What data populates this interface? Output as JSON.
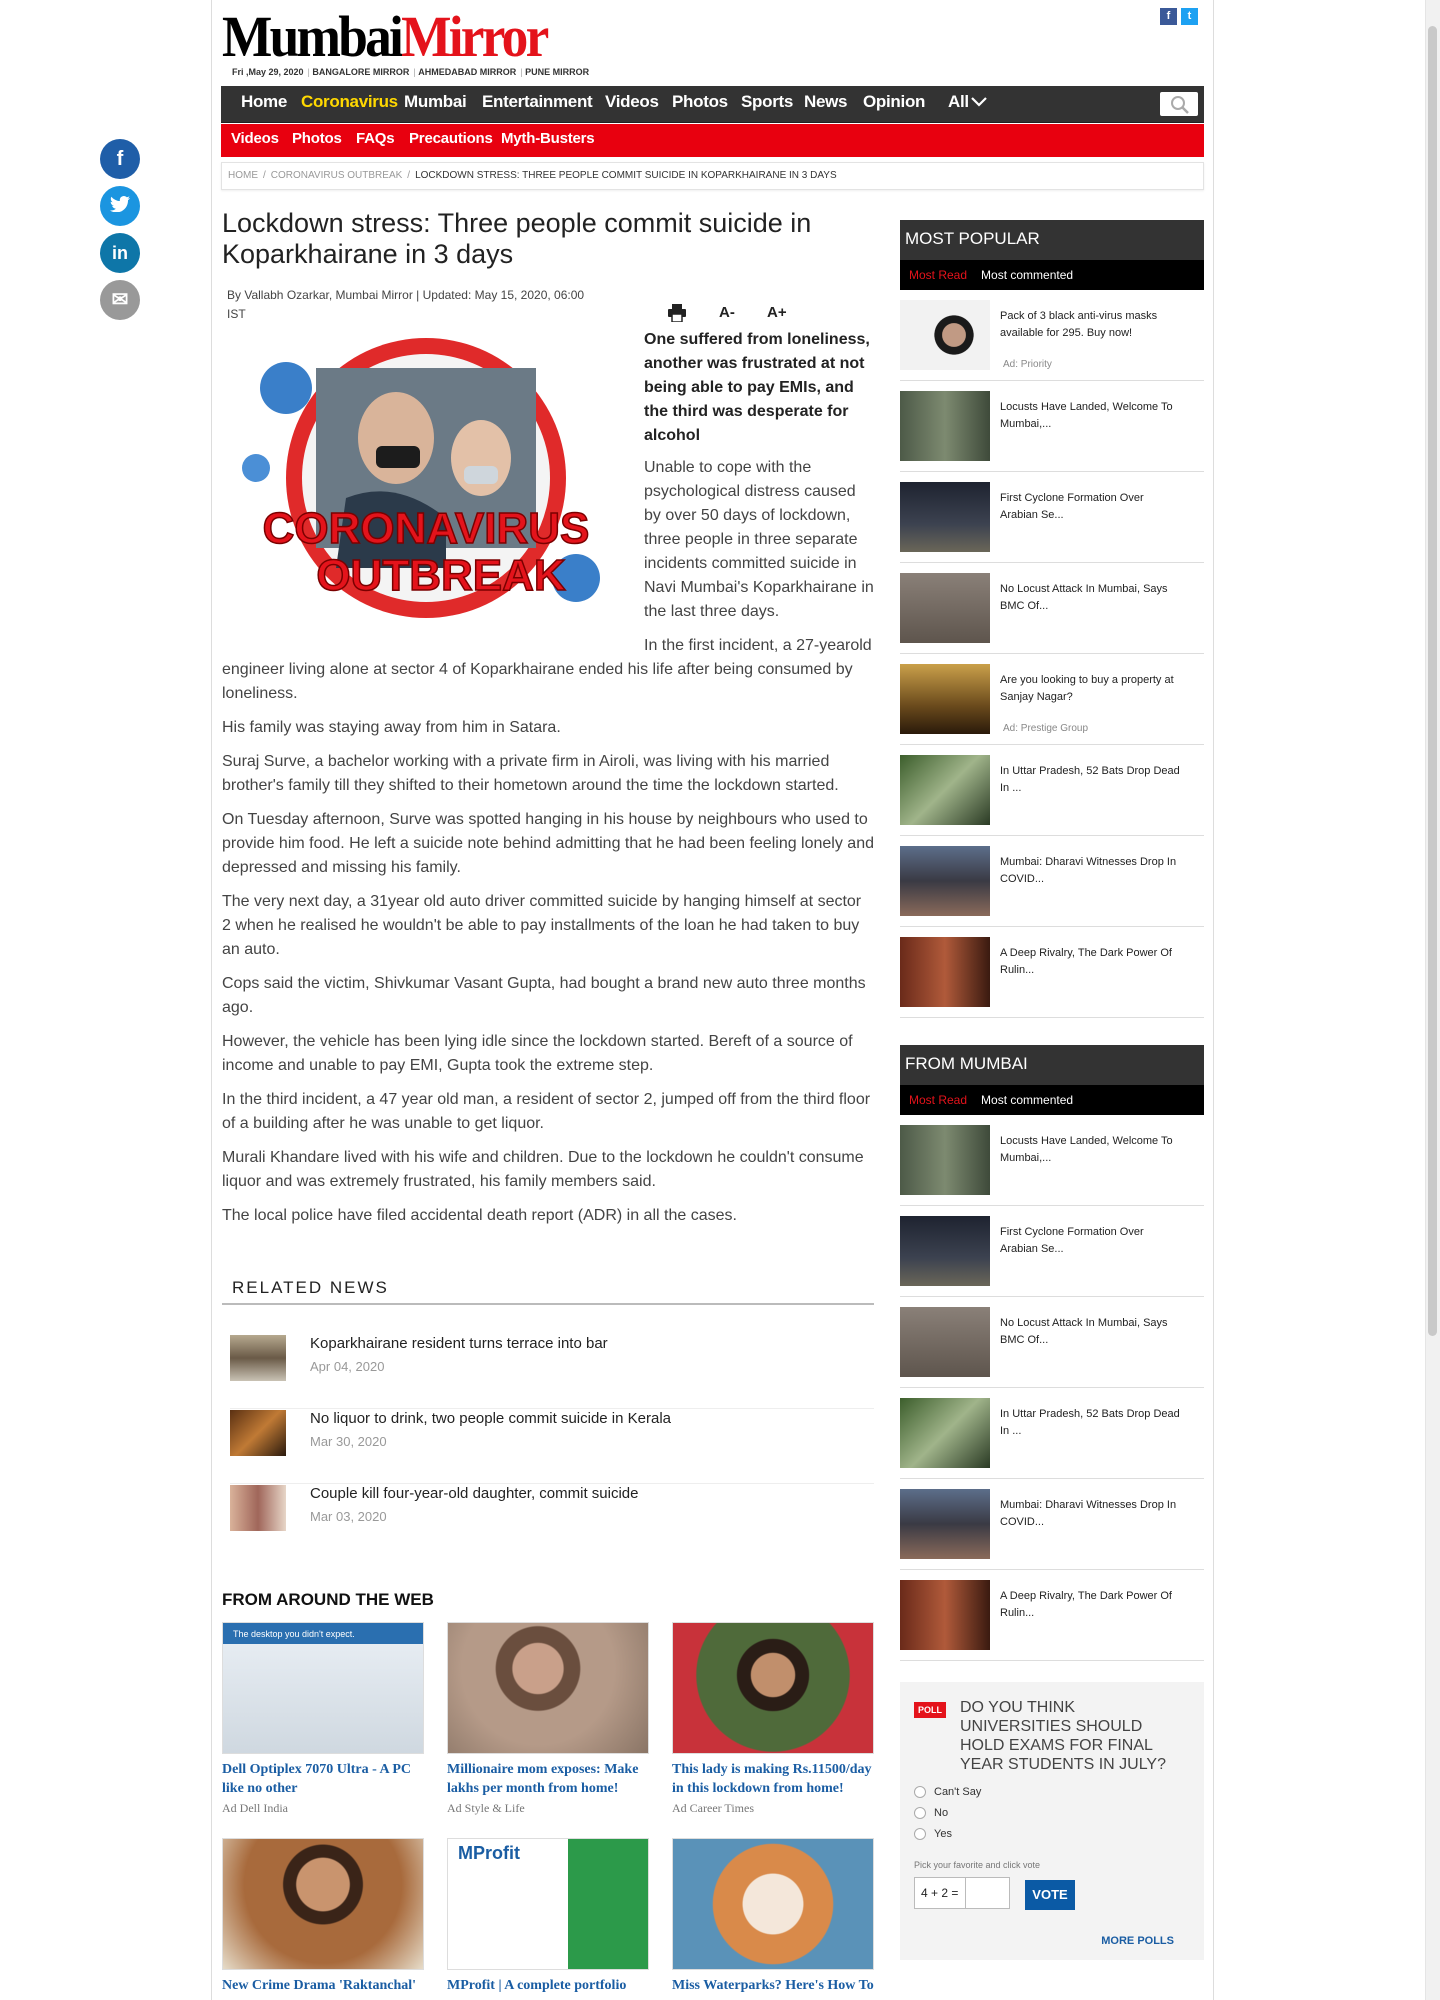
{
  "header": {
    "logo_part1": "Mumbai",
    "logo_part2": "Mirror",
    "date": "Fri ,May 29, 2020",
    "editions": [
      "BANGALORE MIRROR",
      "AHMEDABAD MIRROR",
      "PUNE MIRROR"
    ],
    "facebook": "f",
    "twitter": "t"
  },
  "nav": {
    "items": [
      "Home",
      "Coronavirus",
      "Mumbai",
      "Entertainment",
      "Videos",
      "Photos",
      "Sports",
      "News",
      "Opinion",
      "All"
    ],
    "active": "Coronavirus"
  },
  "subnav": {
    "items": [
      "Videos",
      "Photos",
      "FAQs",
      "Precautions",
      "Myth-Busters"
    ]
  },
  "breadcrumb": [
    "HOME",
    "CORONAVIRUS OUTBREAK",
    "LOCKDOWN STRESS: THREE PEOPLE COMMIT SUICIDE IN KOPARKHAIRANE IN 3 DAYS"
  ],
  "article": {
    "title": "Lockdown stress: Three people commit suicide in Koparkhairane in 3 days",
    "byline": "By Vallabh Ozarkar, Mumbai Mirror | Updated: May 15, 2020, 06:00 IST",
    "font_minus": "A-",
    "font_plus": "A+",
    "image_text_1": "CORONAVIRUS",
    "image_text_2": "OUTBREAK",
    "lead": "One suffered from loneliness, another was frustrated at not being able to pay EMIs, and the third was desperate for alcohol",
    "paragraphs": [
      "Unable to cope with the psychological distress caused by over 50 days of lockdown, three people in three separate incidents committed suicide in Navi Mumbai's Koparkhairane in the last three days.",
      "In the first incident, a 27-yearold engineer living alone at sector 4 of Koparkhairane ended his life after being consumed by loneliness.",
      "His family was staying away from him in Satara.",
      "Suraj Surve, a bachelor working with a private firm in Airoli, was living with his married brother's family till they shifted to their hometown around the time the lockdown started.",
      "On Tuesday afternoon, Surve was spotted hanging in his house by neighbours who used to provide him food. He left a suicide note behind admitting that he had been feeling lonely and depressed and missing his family.",
      "The very next day, a 31year old auto driver committed suicide by hanging himself at sector 2 when he realised he wouldn't be able to pay installments of the loan he had taken to buy an auto.",
      "Cops said the victim, Shivkumar Vasant Gupta, had bought a brand new auto three months ago.",
      "However, the vehicle has been lying idle since the lockdown started. Bereft of a source of income and unable to pay EMI, Gupta took the extreme step.",
      "In the third incident, a 47 year old man, a resident of sector 2, jumped off from the third floor of a building after he was unable to get liquor.",
      "Murali Khandare lived with his wife and children. Due to the lockdown he couldn't consume liquor and was extremely frustrated, his family members said.",
      "The local police have filed accidental death report (ADR) in all the cases."
    ]
  },
  "related": {
    "heading": "RELATED NEWS",
    "items": [
      {
        "title": "Koparkhairane resident turns terrace into bar",
        "date": "Apr 04, 2020"
      },
      {
        "title": "No liquor to drink, two people commit suicide in Kerala",
        "date": "Mar 30, 2020"
      },
      {
        "title": "Couple kill four-year-old daughter, commit suicide",
        "date": "Mar 03, 2020"
      }
    ]
  },
  "around_web": {
    "heading": "FROM AROUND THE WEB",
    "cards": [
      {
        "title": "Dell Optiplex 7070 Ultra - A PC like no other",
        "ad": "Ad  Dell India"
      },
      {
        "title": "Millionaire mom exposes: Make lakhs per month from home!",
        "ad": "Ad  Style & Life"
      },
      {
        "title": "This lady is making Rs.11500/day in this lockdown from home!",
        "ad": "Ad  Career Times"
      },
      {
        "title": "New Crime Drama 'Raktanchal'",
        "ad": ""
      },
      {
        "title": "MProfit | A complete portfolio",
        "ad": ""
      },
      {
        "title": "Miss Waterparks? Here's How To",
        "ad": ""
      }
    ],
    "dell_banner": "The desktop you didn't expect.",
    "mprofit": "MProfit"
  },
  "most_popular": {
    "heading": "MOST POPULAR",
    "tab_a": "Most Read",
    "tab_b": "Most commented",
    "items": [
      {
        "title": "Pack of 3 black anti-virus masks available for 295. Buy now!",
        "ad": "Ad: Priority",
        "is_ad": true
      },
      {
        "title": "Locusts Have Landed, Welcome To Mumbai,...",
        "ad": "",
        "is_ad": false
      },
      {
        "title": "First Cyclone Formation Over Arabian Se...",
        "ad": "",
        "is_ad": false
      },
      {
        "title": "No Locust Attack In Mumbai, Says BMC Of...",
        "ad": "",
        "is_ad": false
      },
      {
        "title": "Are you looking to buy a property at Sanjay Nagar?",
        "ad": "Ad: Prestige Group",
        "is_ad": true
      },
      {
        "title": "In Uttar Pradesh, 52 Bats Drop Dead In ...",
        "ad": "",
        "is_ad": false
      },
      {
        "title": "Mumbai: Dharavi Witnesses Drop In COVID...",
        "ad": "",
        "is_ad": false
      },
      {
        "title": "A Deep Rivalry, The Dark Power Of Rulin...",
        "ad": "",
        "is_ad": false
      }
    ]
  },
  "from_mumbai": {
    "heading": "FROM MUMBAI",
    "tab_a": "Most Read",
    "tab_b": "Most commented",
    "items": [
      "Locusts Have Landed, Welcome To Mumbai,...",
      "First Cyclone Formation Over Arabian Se...",
      "No Locust Attack In Mumbai, Says BMC Of...",
      "In Uttar Pradesh, 52 Bats Drop Dead In ...",
      "Mumbai: Dharavi Witnesses Drop In COVID...",
      "A Deep Rivalry, The Dark Power Of Rulin..."
    ]
  },
  "poll": {
    "tag": "POLL",
    "question": "DO YOU THINK UNIVERSITIES SHOULD HOLD EXAMS FOR FINAL YEAR STUDENTS IN JULY?",
    "options": [
      "Can't Say",
      "No",
      "Yes"
    ],
    "pick": "Pick your favorite and click vote",
    "captcha": "4 + 2 =",
    "vote": "VOTE",
    "more": "MORE POLLS"
  },
  "share": {
    "facebook": "f",
    "twitter": "t",
    "linkedin": "in",
    "email": "✉"
  },
  "colors": {
    "brand_red": "#e4131b",
    "nav_dark": "#333333",
    "active_yellow": "#ffd800",
    "link_blue": "#1a5da3"
  }
}
